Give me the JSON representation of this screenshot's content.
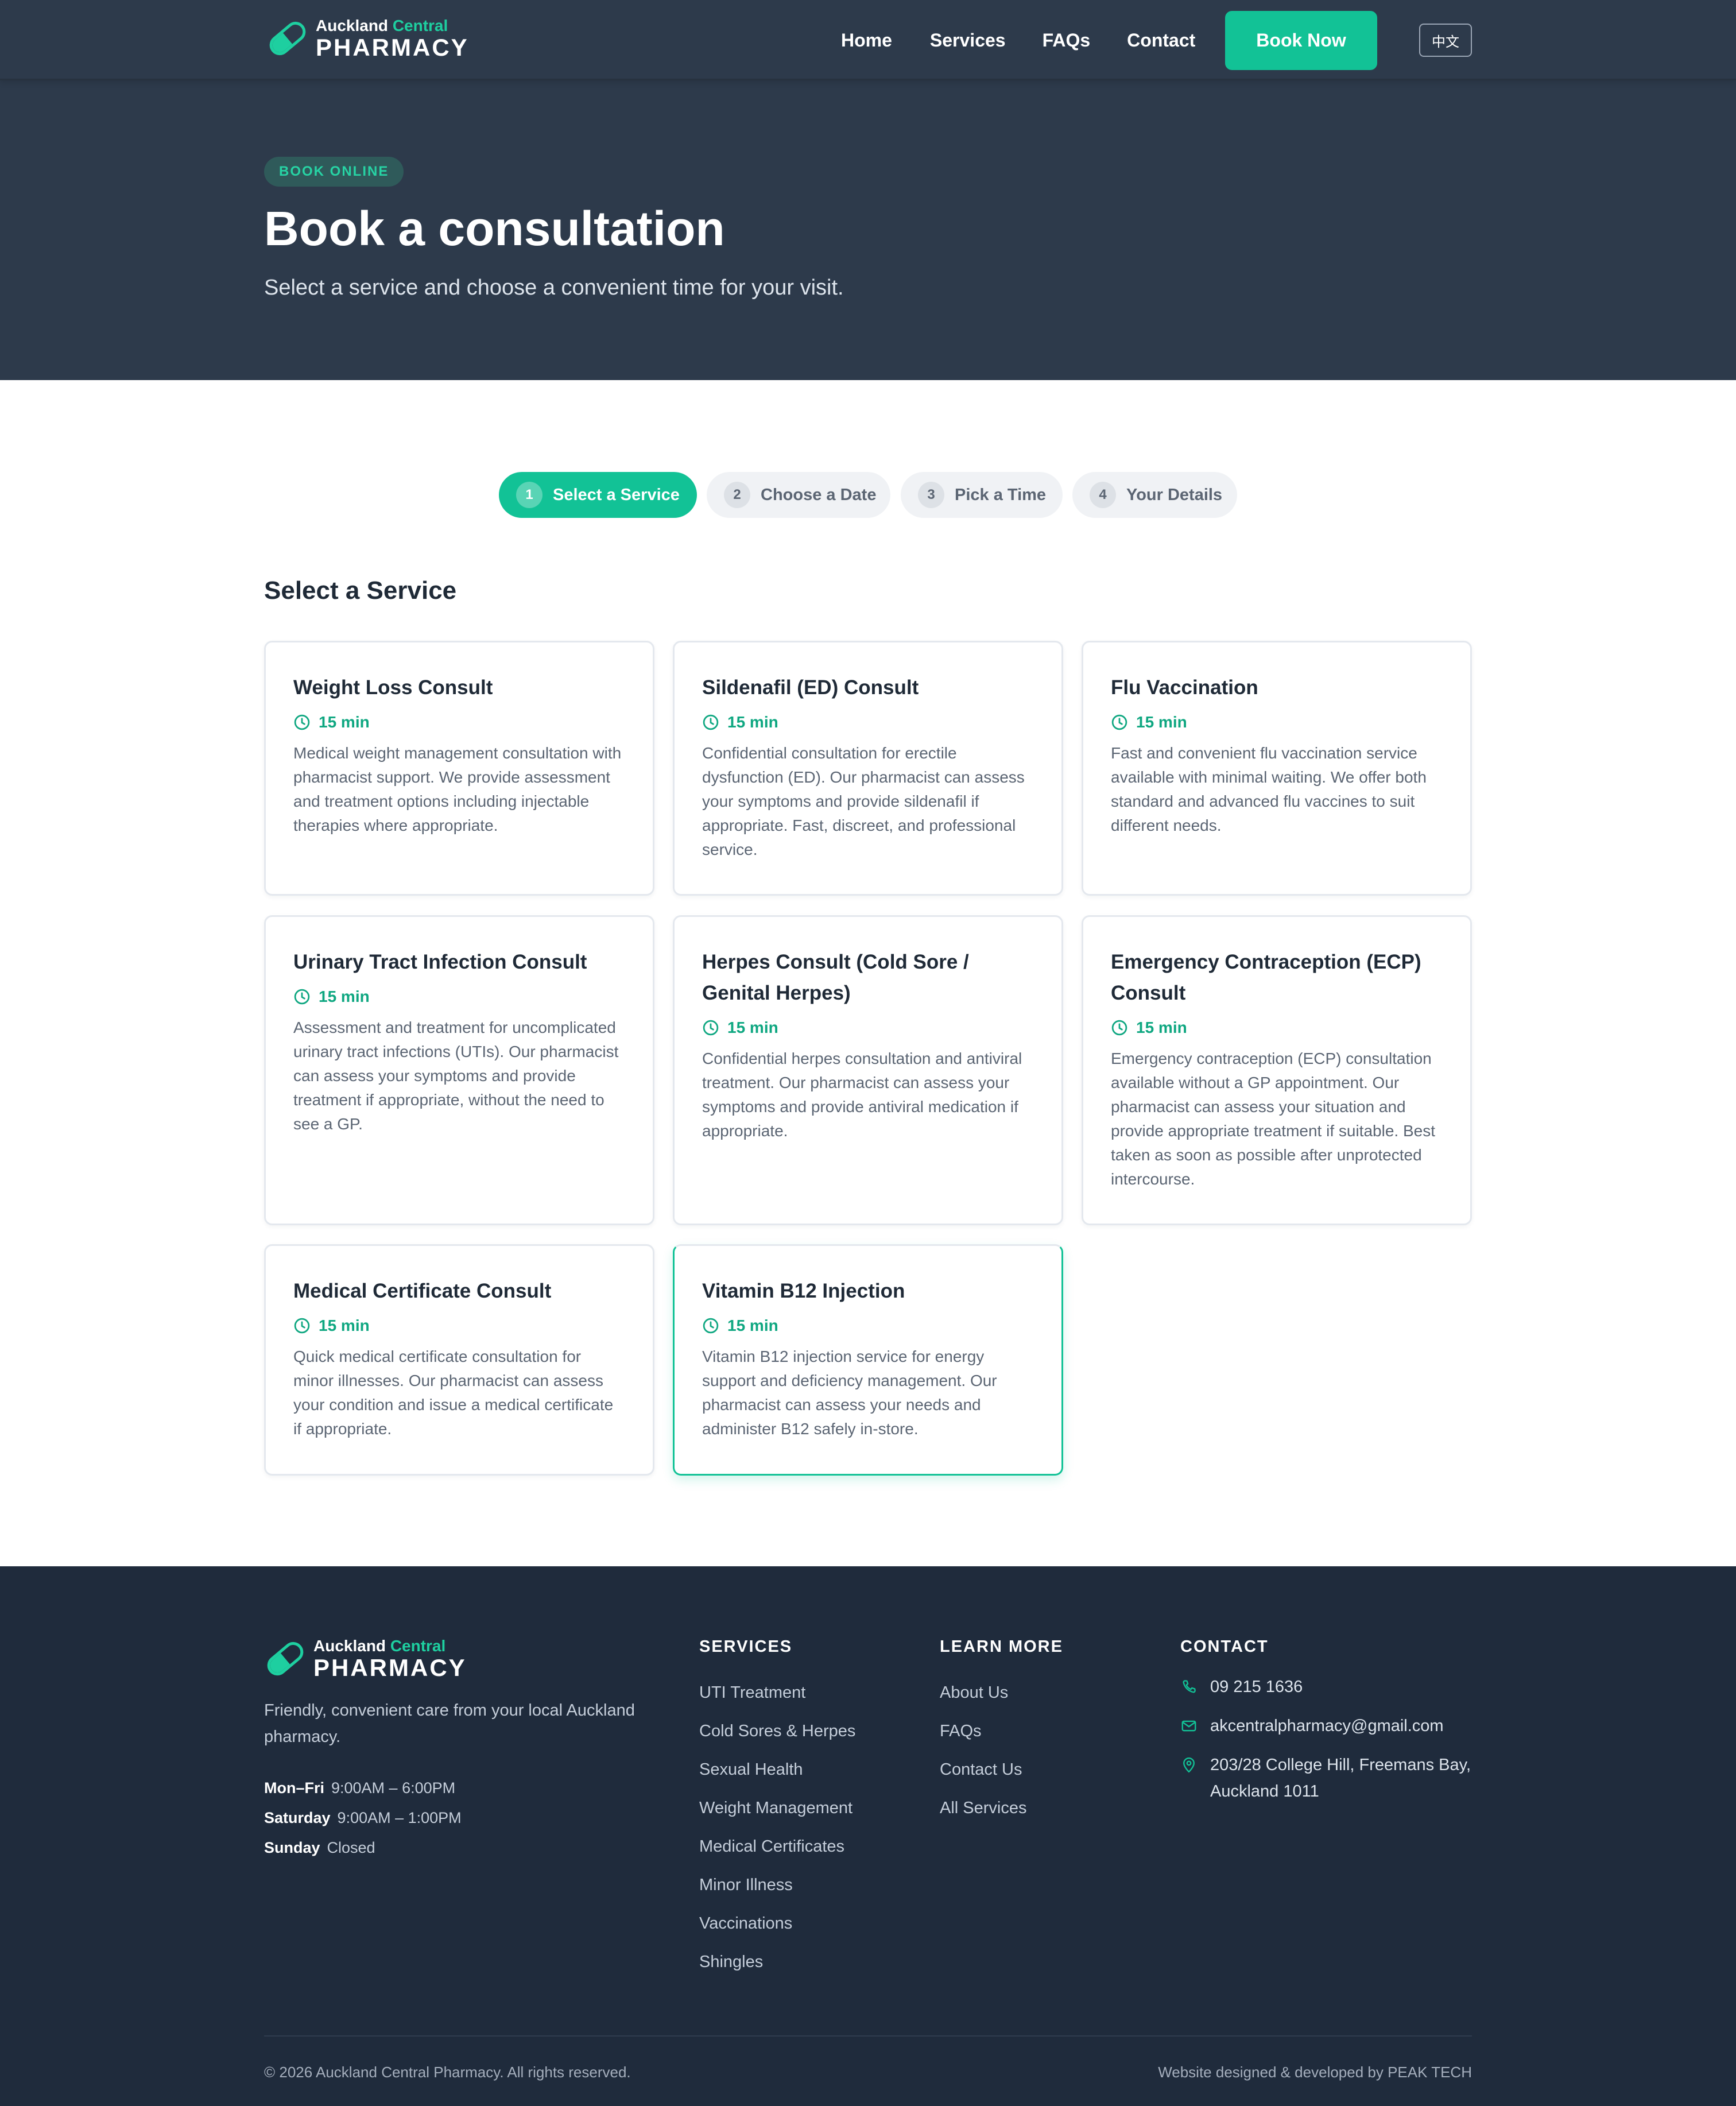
{
  "brand": {
    "line1_main": "Auckland",
    "line1_accent": "Central",
    "line2": "PHARMACY"
  },
  "nav": {
    "links": [
      "Home",
      "Services",
      "FAQs",
      "Contact"
    ],
    "book_label": "Book Now",
    "lang_label": "中文"
  },
  "hero": {
    "badge": "BOOK ONLINE",
    "title": "Book a consultation",
    "subtitle": "Select a service and choose a convenient time for your visit."
  },
  "steps": [
    {
      "num": "1",
      "label": "Select a Service",
      "active": true
    },
    {
      "num": "2",
      "label": "Choose a Date",
      "active": false
    },
    {
      "num": "3",
      "label": "Pick a Time",
      "active": false
    },
    {
      "num": "4",
      "label": "Your Details",
      "active": false
    }
  ],
  "section_title": "Select a Service",
  "services": [
    {
      "title": "Weight Loss Consult",
      "duration": "15 min",
      "description": "Medical weight management consultation with pharmacist support. We provide assessment and treatment options including injectable therapies where appropriate."
    },
    {
      "title": "Sildenafil (ED) Consult",
      "duration": "15 min",
      "description": "Confidential consultation for erectile dysfunction (ED). Our pharmacist can assess your symptoms and provide sildenafil if appropriate. Fast, discreet, and professional service."
    },
    {
      "title": "Flu Vaccination",
      "duration": "15 min",
      "description": "Fast and convenient flu vaccination service available with minimal waiting. We offer both standard and advanced flu vaccines to suit different needs."
    },
    {
      "title": "Urinary Tract Infection Consult",
      "duration": "15 min",
      "description": "Assessment and treatment for uncomplicated urinary tract infections (UTIs). Our pharmacist can assess your symptoms and provide treatment if appropriate, without the need to see a GP."
    },
    {
      "title": "Herpes Consult (Cold Sore / Genital Herpes)",
      "duration": "15 min",
      "description": "Confidential herpes consultation and antiviral treatment. Our pharmacist can assess your symptoms and provide antiviral medication if appropriate."
    },
    {
      "title": "Emergency Contraception (ECP) Consult",
      "duration": "15 min",
      "description": "Emergency contraception (ECP) consultation available without a GP appointment. Our pharmacist can assess your situation and provide appropriate treatment if suitable. Best taken as soon as possible after unprotected intercourse."
    },
    {
      "title": "Medical Certificate Consult",
      "duration": "15 min",
      "description": "Quick medical certificate consultation for minor illnesses. Our pharmacist can assess your condition and issue a medical certificate if appropriate."
    },
    {
      "title": "Vitamin B12 Injection",
      "duration": "15 min",
      "description": "Vitamin B12 injection service for energy support and deficiency management. Our pharmacist can assess your needs and administer B12 safely in-store."
    }
  ],
  "footer": {
    "tagline": "Friendly, convenient care from your local Auckland pharmacy.",
    "hours": [
      {
        "day": "Mon–Fri",
        "time": "9:00AM – 6:00PM"
      },
      {
        "day": "Saturday",
        "time": "9:00AM – 1:00PM"
      },
      {
        "day": "Sunday",
        "time": "Closed"
      }
    ],
    "services_title": "SERVICES",
    "services_links": [
      "UTI Treatment",
      "Cold Sores & Herpes",
      "Sexual Health",
      "Weight Management",
      "Medical Certificates",
      "Minor Illness",
      "Vaccinations",
      "Shingles"
    ],
    "learn_title": "LEARN MORE",
    "learn_links": [
      "About Us",
      "FAQs",
      "Contact Us",
      "All Services"
    ],
    "contact_title": "CONTACT",
    "phone": "09 215 1636",
    "email": "akcentralpharmacy@gmail.com",
    "address": "203/28 College Hill, Freemans Bay, Auckland 1011",
    "copyright": "© 2026 Auckland Central Pharmacy. All rights reserved.",
    "credit": "Website designed & developed by PEAK TECH"
  },
  "icons": {
    "logo": "pill-capsule-icon",
    "duration": "clock-icon",
    "phone": "phone-icon",
    "email": "mail-icon",
    "address": "map-pin-icon"
  },
  "colors": {
    "accent": "#12c296",
    "navy": "#2d3a4b",
    "footer": "#1f2b3c"
  }
}
